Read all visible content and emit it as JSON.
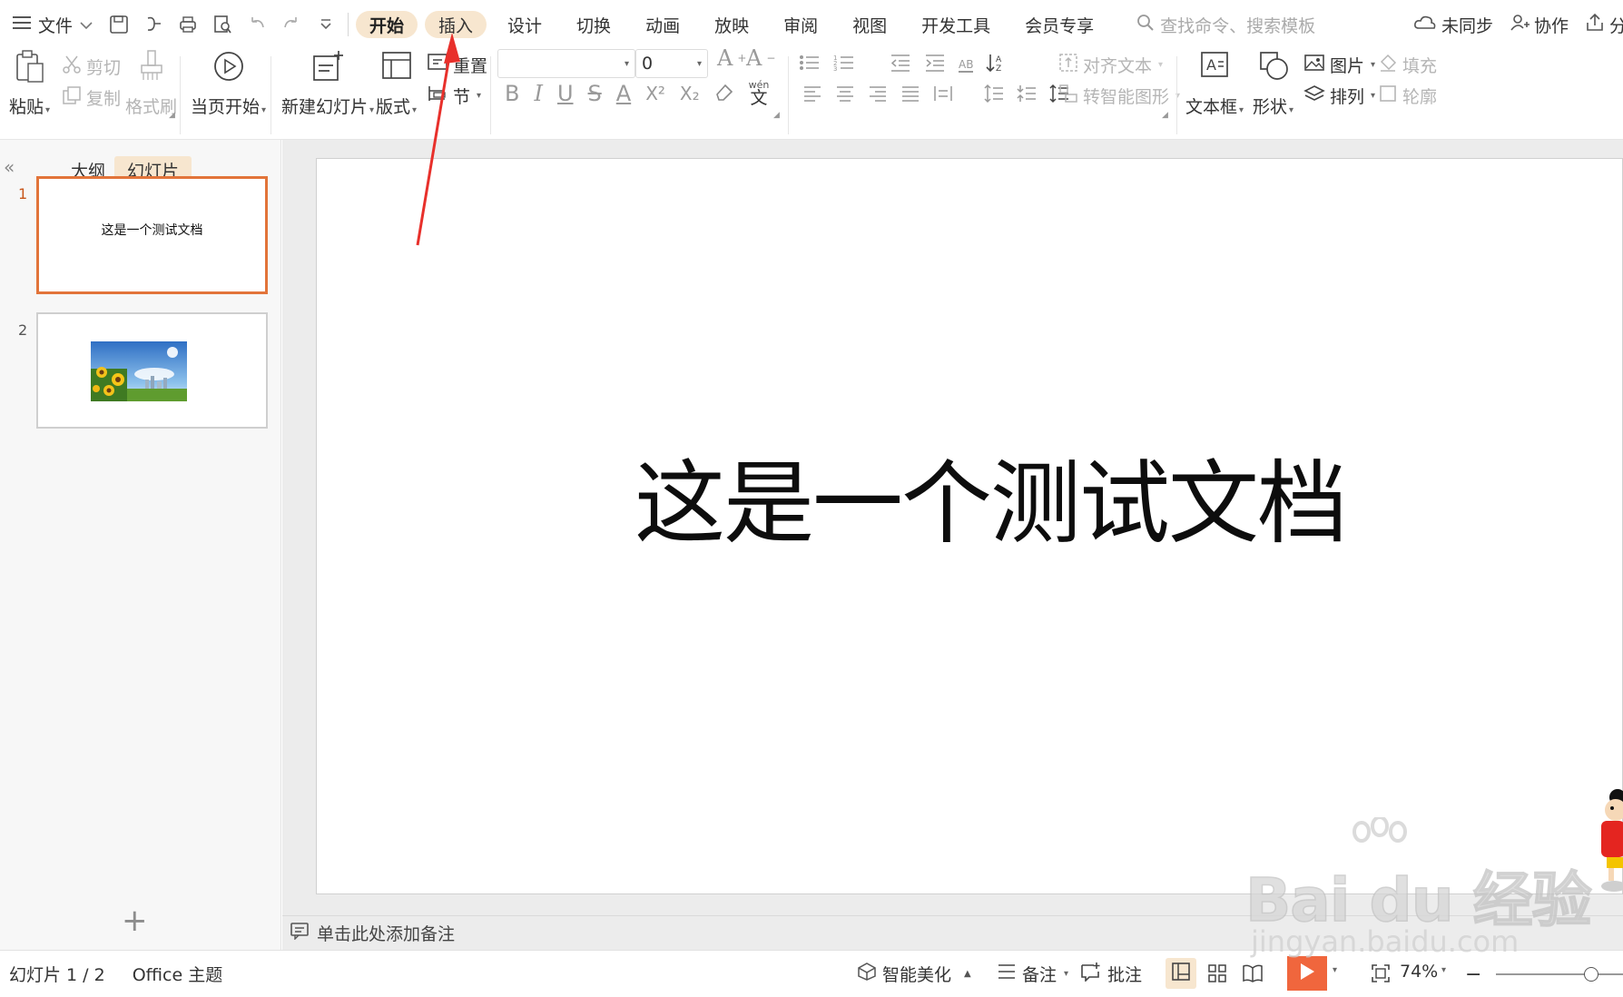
{
  "menu": {
    "file_label": "文件",
    "tabs": [
      {
        "label": "开始",
        "state": "active"
      },
      {
        "label": "插入",
        "state": "hover"
      },
      {
        "label": "设计",
        "state": ""
      },
      {
        "label": "切换",
        "state": ""
      },
      {
        "label": "动画",
        "state": ""
      },
      {
        "label": "放映",
        "state": ""
      },
      {
        "label": "审阅",
        "state": ""
      },
      {
        "label": "视图",
        "state": ""
      },
      {
        "label": "开发工具",
        "state": ""
      },
      {
        "label": "会员专享",
        "state": ""
      }
    ],
    "search_placeholder": "查找命令、搜索模板",
    "right": {
      "sync": "未同步",
      "collab": "协作",
      "share": "分"
    }
  },
  "ribbon": {
    "paste": "粘贴",
    "cut": "剪切",
    "copy": "复制",
    "format_painter": "格式刷",
    "from_current": "当页开始",
    "new_slide": "新建幻灯片",
    "layout": "版式",
    "reset": "重置",
    "section": "节",
    "font_name": "",
    "font_size": "0",
    "align_text": "对齐文本",
    "smart_art": "转智能图形",
    "text_box": "文本框",
    "shape": "形状",
    "picture": "图片",
    "arrange": "排列",
    "fill": "填充",
    "outline": "轮廓",
    "glyphs": {
      "grow": "A",
      "shrink": "A",
      "bold": "B",
      "italic": "I",
      "underline": "U",
      "strike": "S",
      "fontcolor": "A",
      "superscript": "X²",
      "subscript": "X₂",
      "phonetic_top": "wén",
      "phonetic_bottom": "文",
      "ab": "AB"
    }
  },
  "left_pane": {
    "tab_outline": "大纲",
    "tab_slides": "幻灯片",
    "slides": [
      {
        "number": "1",
        "text": "这是一个测试文档",
        "selected": true
      },
      {
        "number": "2",
        "text": "",
        "selected": false,
        "has_image": true
      }
    ],
    "add_label": "+"
  },
  "slide": {
    "title": "这是一个测试文档"
  },
  "notes": {
    "placeholder": "单击此处添加备注"
  },
  "status": {
    "slide_counter": "幻灯片 1 / 2",
    "theme": "Office 主题",
    "smart_beautify": "智能美化",
    "notes_btn": "备注",
    "comment_btn": "批注",
    "zoom": "74%",
    "zoom_level": 0.75
  },
  "watermark": {
    "brand": "Bai du 经验",
    "url": "jingyan.baidu.com"
  },
  "colors": {
    "accent_tab": "#f7e6cf",
    "selected_border": "#e2743a",
    "play_button": "#f0663d",
    "annotation_arrow": "#e8302b"
  }
}
